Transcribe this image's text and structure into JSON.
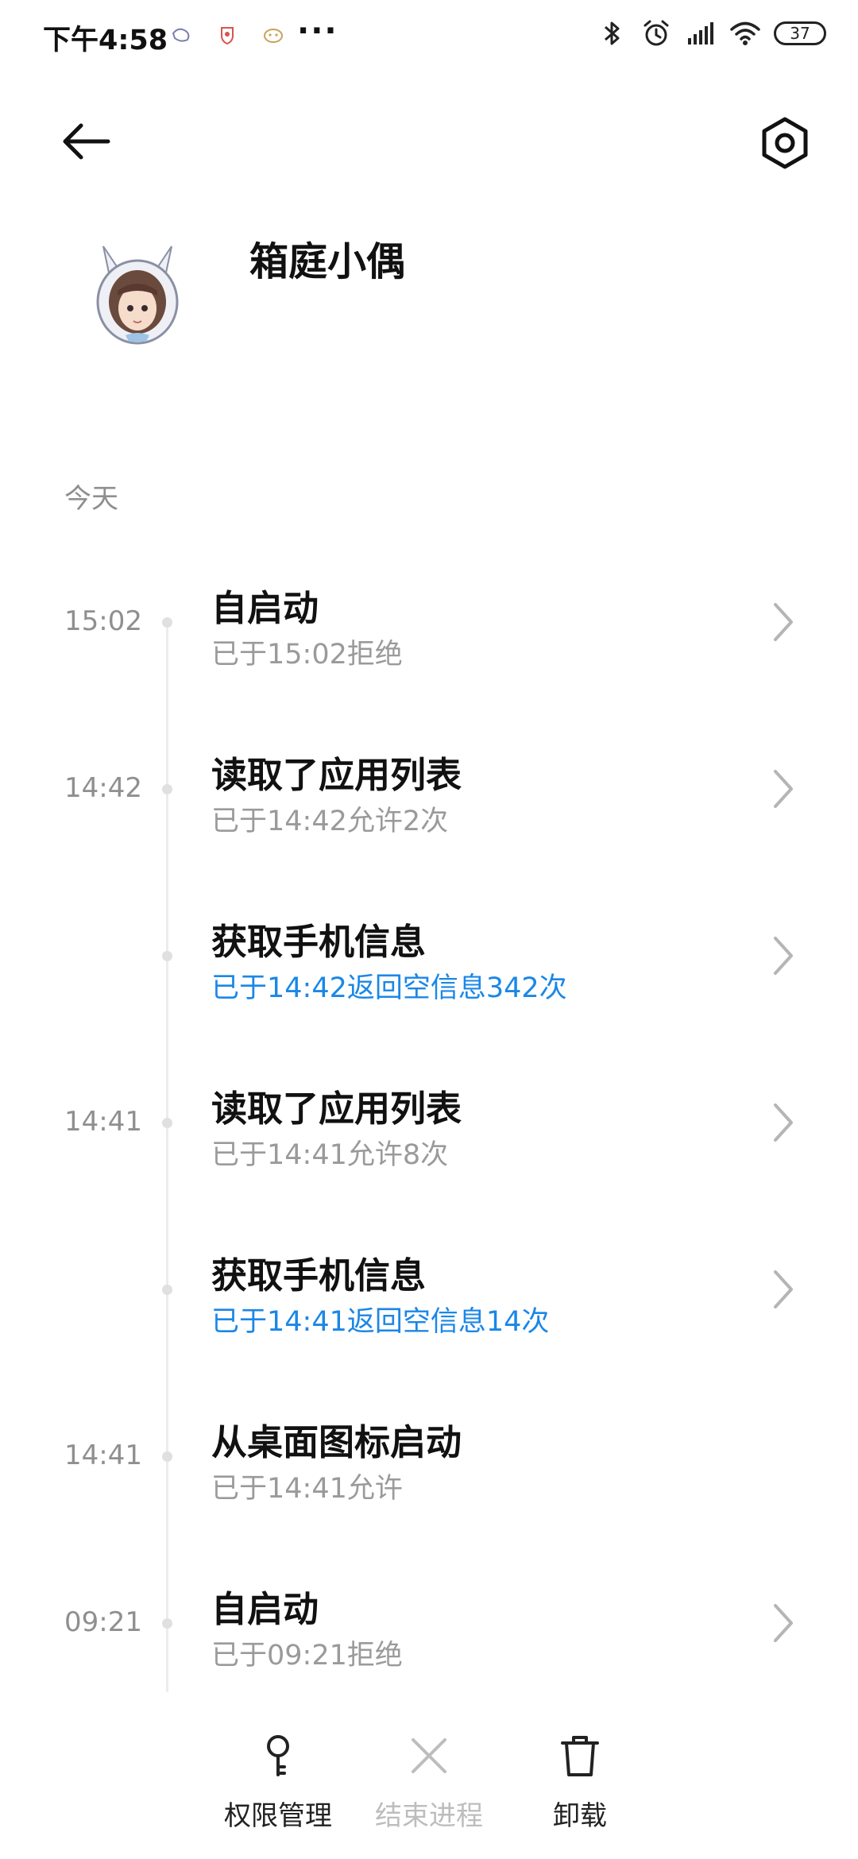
{
  "status_bar": {
    "time": "下午4:58",
    "more": "···",
    "battery": "37",
    "icons": [
      "notification-icon-1",
      "notification-icon-2",
      "notification-icon-3",
      "bluetooth-icon",
      "alarm-icon",
      "signal-icon",
      "wifi-icon",
      "battery-icon"
    ]
  },
  "header": {
    "back_icon": "back-arrow-icon",
    "settings_icon": "settings-hexagon-icon"
  },
  "app": {
    "name": "箱庭小偶",
    "icon": "app-avatar-icon"
  },
  "section": {
    "label": "今天"
  },
  "entries": [
    {
      "time": "15:02",
      "title": "自启动",
      "subtitle": "已于15:02拒绝",
      "highlight": false,
      "chevron": true
    },
    {
      "time": "14:42",
      "title": "读取了应用列表",
      "subtitle": "已于14:42允许2次",
      "highlight": false,
      "chevron": true
    },
    {
      "time": "",
      "title": "获取手机信息",
      "subtitle": "已于14:42返回空信息342次",
      "highlight": true,
      "chevron": true
    },
    {
      "time": "14:41",
      "title": "读取了应用列表",
      "subtitle": "已于14:41允许8次",
      "highlight": false,
      "chevron": true
    },
    {
      "time": "",
      "title": "获取手机信息",
      "subtitle": "已于14:41返回空信息14次",
      "highlight": true,
      "chevron": true
    },
    {
      "time": "14:41",
      "title": "从桌面图标启动",
      "subtitle": "已于14:41允许",
      "highlight": false,
      "chevron": false
    },
    {
      "time": "09:21",
      "title": "自启动",
      "subtitle": "已于09:21拒绝",
      "highlight": false,
      "chevron": true
    }
  ],
  "bottom_bar": {
    "permissions": "权限管理",
    "end_process": "结束进程",
    "uninstall": "卸载"
  },
  "colors": {
    "highlight": "#1b87e6",
    "secondary_text": "#9a9a9a",
    "disabled": "#bdbdbd"
  }
}
